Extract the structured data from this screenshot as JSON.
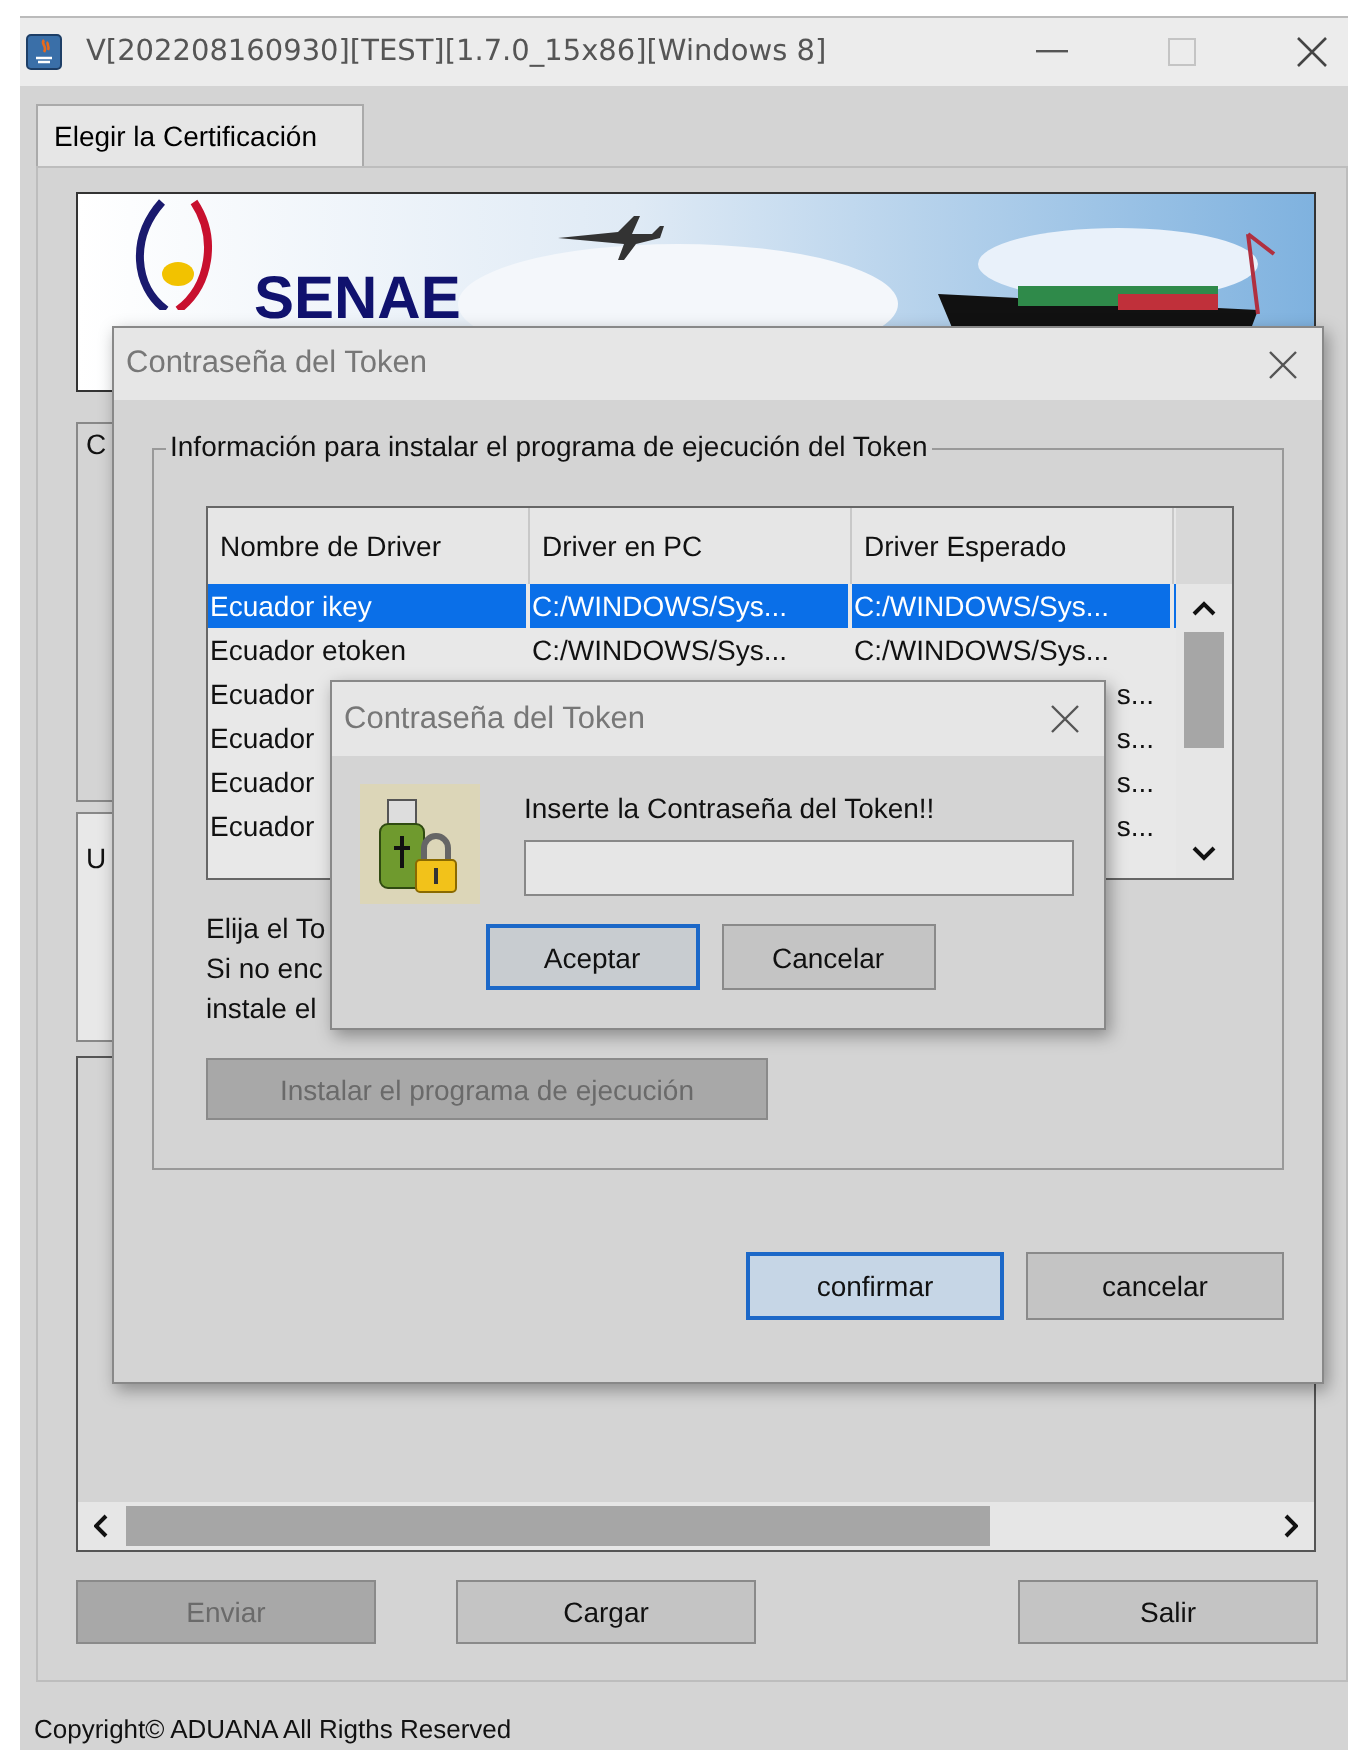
{
  "window": {
    "title": "V[202208160930][TEST][1.7.0_15x86][Windows 8]"
  },
  "tabs": [
    {
      "label": "Elegir la Certificación",
      "selected": true
    }
  ],
  "banner": {
    "kind": "picture",
    "logo_text": "SENAE"
  },
  "panels": [
    {
      "title_fragment": "C"
    },
    {
      "title_fragment": "U"
    }
  ],
  "buttons": [
    {
      "label": "Enviar",
      "disabled": true
    },
    {
      "label": "Cargar",
      "disabled": false
    },
    {
      "label": "Salir",
      "disabled": false
    }
  ],
  "footer": "Copyright© ADUANA All Rigths Reserved",
  "dialog": {
    "title": "Contraseña del Token",
    "group_title": "Información para instalar el programa de ejecución del Token",
    "table": {
      "columns": [
        "Nombre de Driver",
        "Driver en PC",
        "Driver Esperado"
      ],
      "rows": [
        {
          "name": "Ecuador ikey",
          "driver_pc": "C:/WINDOWS/Sys...",
          "driver_expected": "C:/WINDOWS/Sys...",
          "selected": true
        },
        {
          "name": "Ecuador etoken",
          "driver_pc": "C:/WINDOWS/Sys...",
          "driver_expected": "C:/WINDOWS/Sys...",
          "selected": false
        },
        {
          "name": "Ecuador",
          "driver_expected": "s...",
          "selected": false
        },
        {
          "name": "Ecuador",
          "driver_expected": "s...",
          "selected": false
        },
        {
          "name": "Ecuador",
          "driver_expected": "s...",
          "selected": false
        },
        {
          "name": "Ecuador",
          "driver_expected": "s...",
          "selected": false
        }
      ]
    },
    "help_lines": [
      "Elija el To",
      "Si no enc",
      "instale el"
    ],
    "install_button": {
      "label": "Instalar el programa de ejecución",
      "disabled": true
    },
    "buttons": [
      {
        "label": "confirmar",
        "focused": true
      },
      {
        "label": "cancelar",
        "focused": false
      }
    ]
  },
  "password_dialog": {
    "title": "Contraseña del Token",
    "prompt": "Inserte la Contraseña del Token!!",
    "buttons": [
      {
        "label": "Aceptar",
        "focused": true
      },
      {
        "label": "Cancelar",
        "focused": false
      }
    ]
  }
}
